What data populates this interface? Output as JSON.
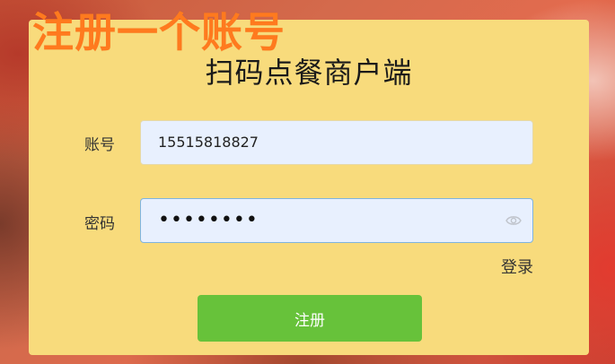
{
  "headline": "注册一个账号",
  "card": {
    "title": "扫码点餐商户端"
  },
  "account": {
    "label": "账号",
    "value": "15515818827"
  },
  "password": {
    "label": "密码",
    "masked_value": "••••••••",
    "toggle_icon": "eye-icon"
  },
  "links": {
    "login": "登录"
  },
  "buttons": {
    "register": "注册"
  },
  "colors": {
    "headline": "#ff7a1e",
    "card_bg": "#f8db7c",
    "input_bg": "#e8f0fe",
    "button_bg": "#67c23a"
  }
}
